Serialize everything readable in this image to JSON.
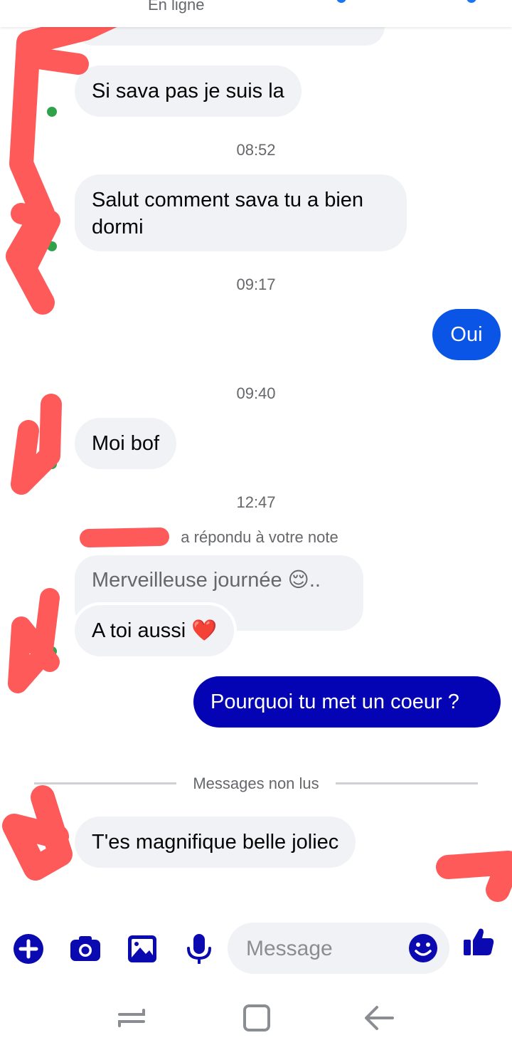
{
  "header": {
    "status": "En ligne"
  },
  "conversation": {
    "messages": [
      {
        "text": "Si sava pas je suis la"
      },
      {
        "time": "08:52"
      },
      {
        "text_line1": "Salut comment sava tu a bien",
        "text_line2": "dormi"
      },
      {
        "time": "09:17"
      },
      {
        "text": "Oui"
      },
      {
        "time": "09:40"
      },
      {
        "text": "Moi bof"
      },
      {
        "time": "12:47"
      },
      {
        "notice": "a répondu à votre note"
      },
      {
        "quote": "Merveilleuse journée 😌.."
      },
      {
        "text": "A toi aussi ❤️"
      },
      {
        "text": "Pourquoi tu met un coeur ?"
      },
      {
        "divider": "Messages non lus"
      },
      {
        "text": "T'es magnifique belle joliec"
      }
    ]
  },
  "composer": {
    "placeholder": "Message",
    "icons": [
      "plus-icon",
      "camera-icon",
      "image-icon",
      "microphone-icon",
      "emoji-icon",
      "thumbs-up-icon"
    ]
  },
  "colors": {
    "accent": "#0a0ab0",
    "outgoing_blue": "#0a54e6",
    "outgoing_darkblue": "#0404b4",
    "incoming_bg": "#f0f2f5",
    "online_green": "#31a24c"
  }
}
